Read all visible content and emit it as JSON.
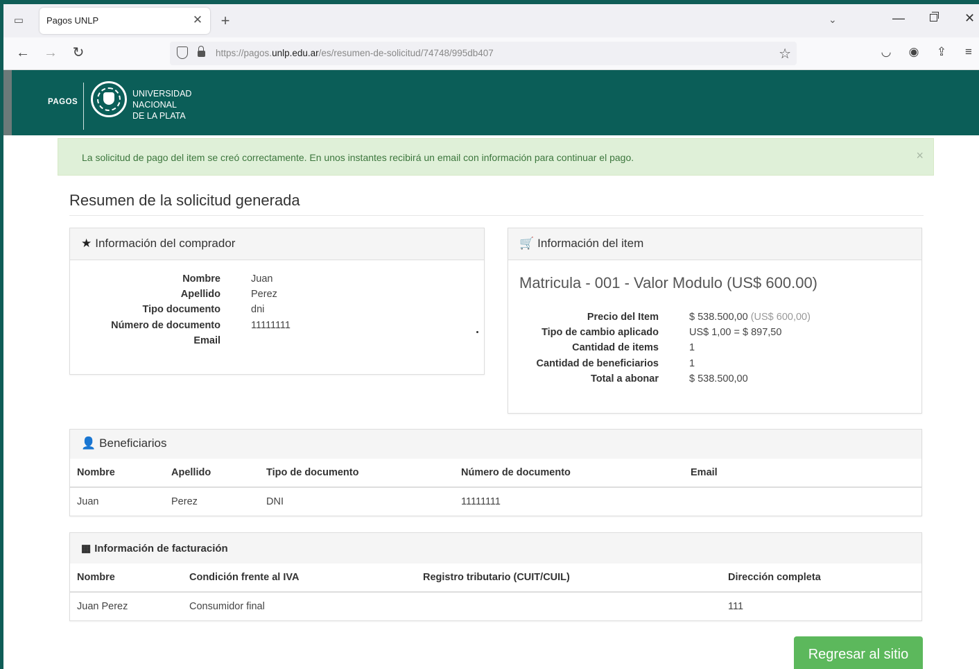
{
  "browser": {
    "tab_title": "Pagos UNLP",
    "tab_close": "✕",
    "new_tab": "+",
    "url_prefix": "https://pagos.",
    "url_host": "unlp.edu.ar",
    "url_path": "/es/resumen-de-solicitud/74748/995db407"
  },
  "header": {
    "pagos_label": "PAGOS",
    "university_line1": "UNIVERSIDAD",
    "university_line2": "NACIONAL",
    "university_line3": "DE LA PLATA"
  },
  "alert": {
    "message": "La solicitud de pago del item se creó correctamente. En unos instantes recibirá un email con información para continuar el pago.",
    "close": "×"
  },
  "page_title": "Resumen de la solicitud generada",
  "buyer": {
    "title": "Información del comprador",
    "fields": [
      {
        "label": "Nombre",
        "value": "Juan"
      },
      {
        "label": "Apellido",
        "value": "Perez"
      },
      {
        "label": "Tipo documento",
        "value": "dni"
      },
      {
        "label": "Número de documento",
        "value": "11111111"
      },
      {
        "label": "Email",
        "value": ""
      }
    ]
  },
  "item": {
    "title": "Información del item",
    "name": "Matricula - 001 - Valor Modulo (US$ 600.00)",
    "fields": [
      {
        "label": "Precio del Item",
        "value": "$ 538.500,00",
        "extra": "(US$ 600,00)"
      },
      {
        "label": "Tipo de cambio aplicado",
        "value": "US$ 1,00 = $ 897,50",
        "extra": ""
      },
      {
        "label": "Cantidad de items",
        "value": "1",
        "extra": ""
      },
      {
        "label": "Cantidad de beneficiarios",
        "value": "1",
        "extra": ""
      },
      {
        "label": "Total a abonar",
        "value": "$ 538.500,00",
        "extra": ""
      }
    ]
  },
  "beneficiaries": {
    "title": "Beneficiarios",
    "columns": [
      "Nombre",
      "Apellido",
      "Tipo de documento",
      "Número de documento",
      "Email"
    ],
    "rows": [
      [
        "Juan",
        "Perez",
        "DNI",
        "11111111",
        ""
      ]
    ]
  },
  "billing": {
    "title": "Información de facturación",
    "columns": [
      "Nombre",
      "Condición frente al IVA",
      "Registro tributario (CUIT/CUIL)",
      "Dirección completa"
    ],
    "rows": [
      [
        "Juan Perez",
        "Consumidor final",
        "",
        "111"
      ]
    ]
  },
  "return_button": "Regresar al sitio",
  "colors": {
    "brand": "#0b5e58",
    "alert_bg": "#dff0d8",
    "alert_text": "#3c763d",
    "button": "#5cb85c"
  }
}
